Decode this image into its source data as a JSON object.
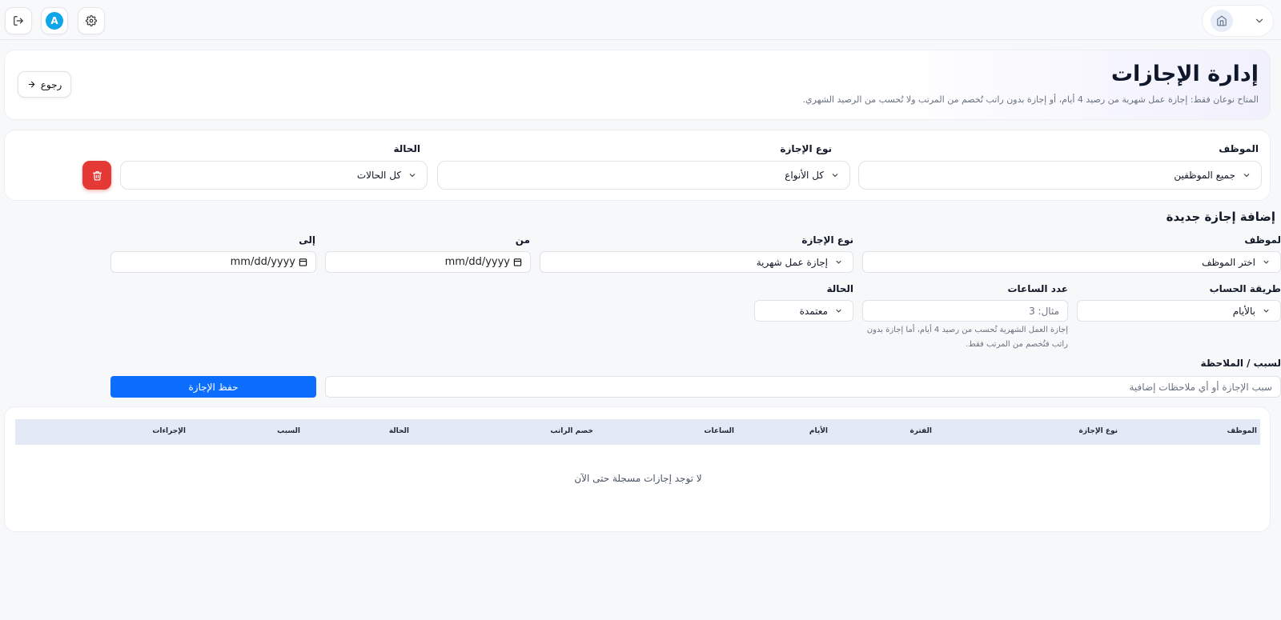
{
  "header": {
    "title": "إدارة الإجازات",
    "subtitle": "المتاح نوعان فقط: إجازة عمل شهرية من رصيد 4 أيام، أو إجازة بدون راتب تُخصم من المرتب ولا تُحسب من الرصيد الشهري.",
    "back_label": "رجوع"
  },
  "topbar": {
    "avatar_letter": "A"
  },
  "filters": {
    "employee_label": "الموظف",
    "employee_value": "جميع الموظفين",
    "type_label": "نوع الإجازة",
    "type_value": "كل الأنواع",
    "status_label": "الحالة",
    "status_value": "كل الحالات"
  },
  "new_leave": {
    "section_title": "إضافة إجازة جديدة",
    "employee_label": "لموظف",
    "employee_value": "اختر الموظف",
    "type_label": "نوع الإجازة",
    "type_value": "إجازة عمل شهرية",
    "from_label": "من",
    "from_value": "mm/dd/yyyy",
    "to_label": "إلى",
    "to_value": "mm/dd/yyyy",
    "calc_label": "طريقة الحساب",
    "calc_value": "بالأيام",
    "hours_label": "عدد الساعات",
    "hours_placeholder": "مثال: 3",
    "hint": "إجازة العمل الشهرية تُحسب من رصيد 4 أيام، أما إجازة بدون راتب فتُخصم من المرتب فقط.",
    "status_label": "الحالة",
    "status_value": "معتمدة",
    "reason_label": "لسبب / الملاحظة",
    "reason_placeholder": "سبب الإجازة أو أي ملاحظات إضافية",
    "save_label": "حفظ الإجازة"
  },
  "table": {
    "columns": [
      "الموظف",
      "نوع الإجازة",
      "الفترة",
      "الأيام",
      "الساعات",
      "خصم الراتب",
      "الحالة",
      "السبب",
      "الإجراءات"
    ],
    "empty_message": "لا توجد إجازات مسجلة حتى الآن"
  },
  "colors": {
    "primary": "#0d6efd",
    "danger": "#e53935",
    "avatar": "#0ea5e9",
    "table_header": "#e3eaf6"
  },
  "icons": [
    "logout-icon",
    "settings-gear-icon",
    "home-icon",
    "chevron-down-icon",
    "arrow-right-icon",
    "trash-icon",
    "calendar-icon"
  ]
}
